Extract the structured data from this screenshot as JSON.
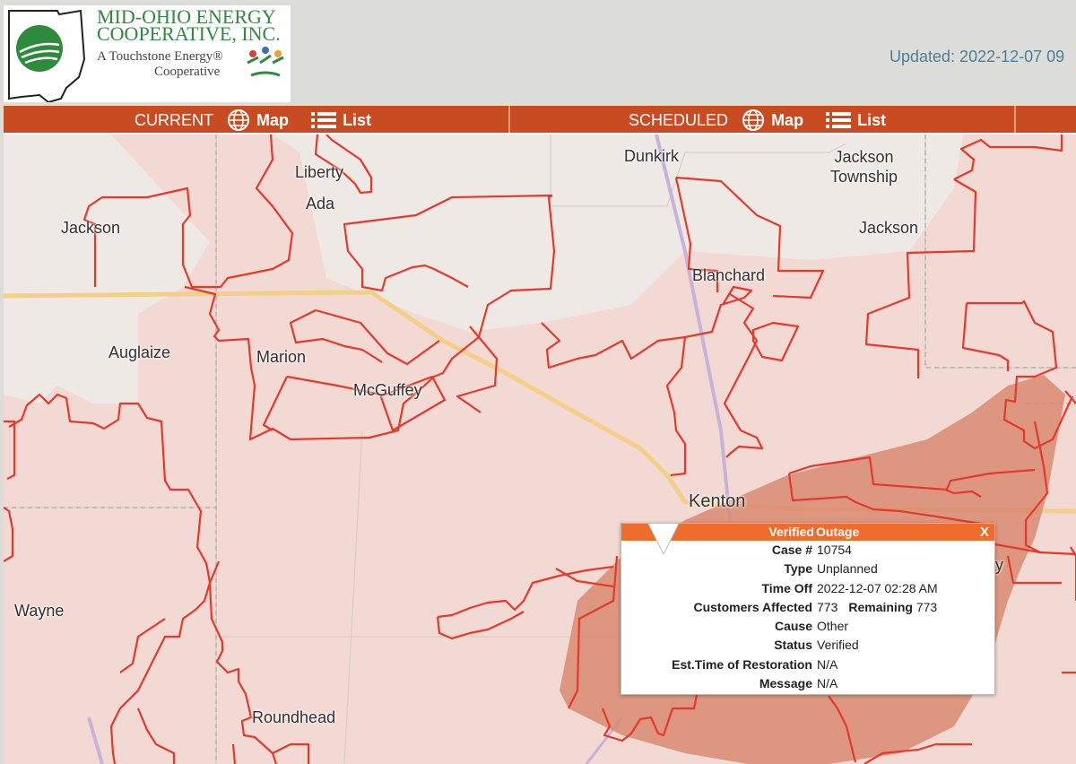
{
  "header": {
    "logo": {
      "line1": "MID-OHIO ENERGY",
      "line2": "COOPERATIVE, INC.",
      "line3": "A Touchstone Energy®",
      "line4": "Cooperative"
    },
    "updated": "Updated: 2022-12-07 09"
  },
  "nav": {
    "current": {
      "label": "CURRENT",
      "map": "Map",
      "list": "List"
    },
    "scheduled": {
      "label": "SCHEDULED",
      "map": "Map",
      "list": "List"
    }
  },
  "map": {
    "places": {
      "liberty": "Liberty",
      "ada": "Ada",
      "dunkirk": "Dunkirk",
      "jackson_township": "Jackson\nTownship",
      "jackson_west": "Jackson",
      "jackson_east": "Jackson",
      "blanchard": "Blanchard",
      "auglaize": "Auglaize",
      "marion": "Marion",
      "mcguffey": "McGuffey",
      "kenton": "Kenton",
      "wayne": "Wayne",
      "roundhead": "Roundhead",
      "partial_y": "y"
    },
    "colors": {
      "territory_fill": "#f2d9d3",
      "boundary": "#e5392b",
      "outage_fill": "#d98a70",
      "highway": "#f4cf8a",
      "rail": "#c8b2d8"
    }
  },
  "popup": {
    "title_word1": "Verified",
    "title_word2": "Outage",
    "close": "X",
    "rows": [
      {
        "key": "Case #",
        "value": "10754"
      },
      {
        "key": "Type",
        "value": "Unplanned"
      },
      {
        "key": "Time Off",
        "value": "2022-12-07 02:28 AM"
      },
      {
        "key": "Customers Affected",
        "value": "773"
      },
      {
        "key": "Cause",
        "value": "Other"
      },
      {
        "key": "Status",
        "value": "Verified"
      },
      {
        "key": "Est.Time of Restoration",
        "value": "N/A"
      },
      {
        "key": "Message",
        "value": "N/A"
      }
    ],
    "remaining_label": "Remaining",
    "remaining_value": "773"
  }
}
